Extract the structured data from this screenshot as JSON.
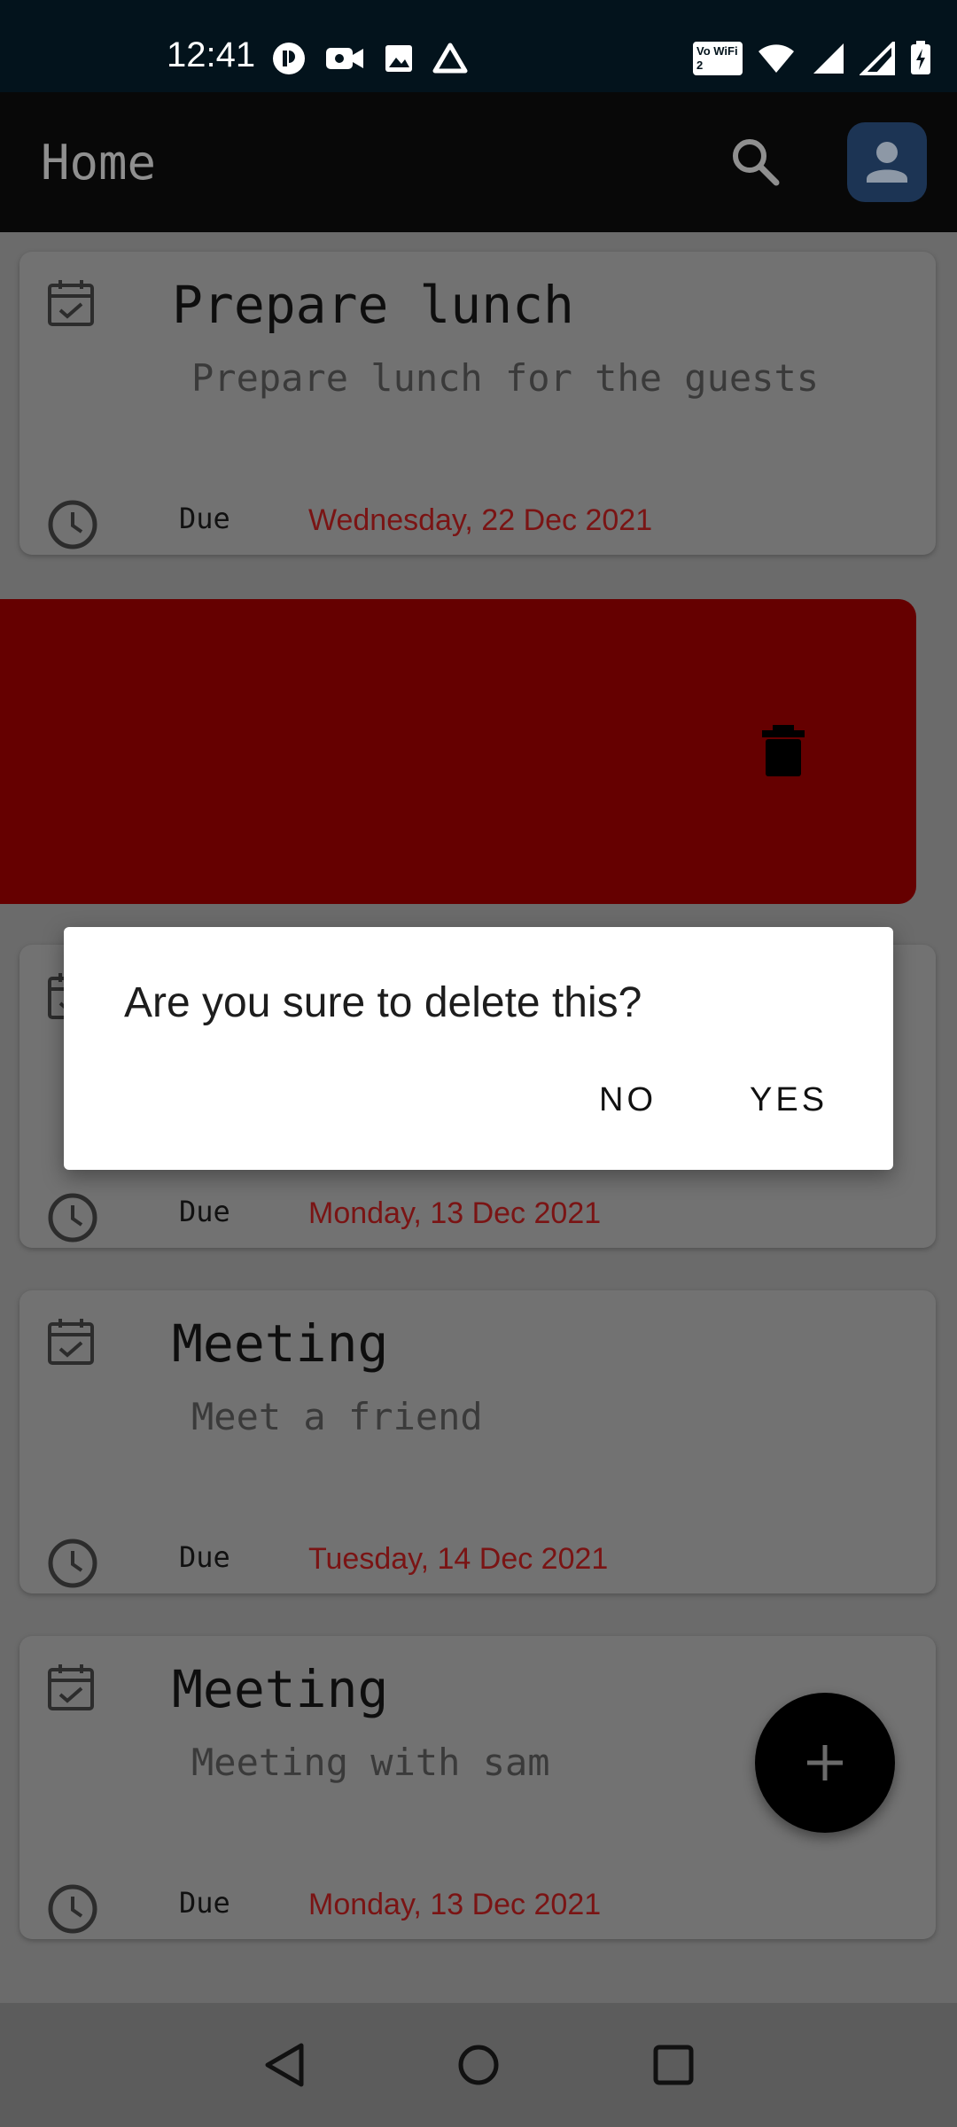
{
  "status_bar": {
    "time": "12:41",
    "left_icons": [
      "notification-app-icon",
      "video-camera-icon",
      "image-icon",
      "drive-icon"
    ],
    "right_icons": [
      "vowifi-icon",
      "wifi-icon",
      "signal-icon",
      "signal-icon",
      "battery-charging-icon"
    ],
    "vowifi_label": "Vo WiFi 2"
  },
  "app_bar": {
    "title": "Home",
    "search_icon": "search-icon",
    "avatar_icon": "person-icon"
  },
  "tasks": [
    {
      "title": "Prepare lunch",
      "description": "Prepare lunch for the guests",
      "due_label": "Due",
      "due_date": "Wednesday, 22 Dec 2021"
    },
    {
      "title": "",
      "description": "",
      "due_label": "Due",
      "due_date": "Monday, 13 Dec 2021"
    },
    {
      "title": "Meeting",
      "description": "Meet a friend",
      "due_label": "Due",
      "due_date": "Tuesday, 14 Dec 2021"
    },
    {
      "title": "Meeting",
      "description": "Meeting with sam",
      "due_label": "Due",
      "due_date": "Monday, 13 Dec 2021"
    }
  ],
  "swipe_delete": {
    "icon": "trash-icon",
    "color": "#650000"
  },
  "dialog": {
    "message": "Are you sure to delete this?",
    "no_label": "NO",
    "yes_label": "YES"
  },
  "fab": {
    "icon": "plus-icon"
  },
  "nav_bar": {
    "back_icon": "back-triangle-icon",
    "home_icon": "home-circle-icon",
    "recents_icon": "recents-square-icon"
  },
  "colors": {
    "due_date": "#7a1414",
    "swipe_background": "#650000",
    "avatar_background": "#1c3454"
  }
}
